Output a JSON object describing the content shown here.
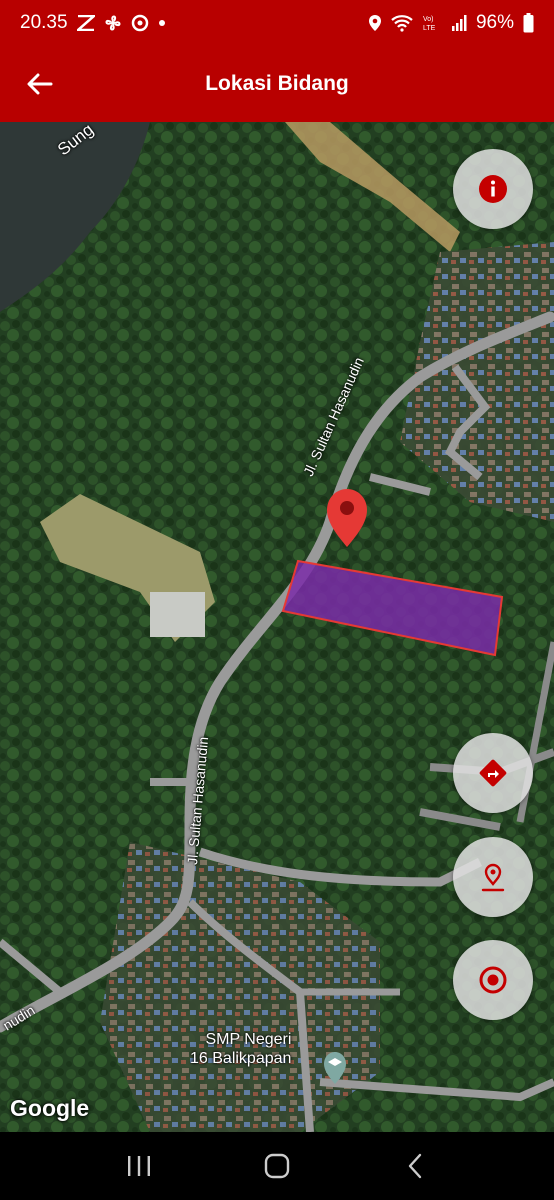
{
  "status_bar": {
    "time": "20.35",
    "battery": "96%",
    "left_icons": [
      "notification-app-icon",
      "fan-icon",
      "camera-app-icon",
      "dot-icon"
    ],
    "right_icons": [
      "location-icon",
      "wifi-icon",
      "volte-icon",
      "signal-icon",
      "battery-icon"
    ],
    "volte_label": "Vo)\nLTE"
  },
  "app_bar": {
    "title": "Lokasi Bidang",
    "back_icon": "arrow-left-icon"
  },
  "map": {
    "water_label": "Sung",
    "road_label_1": "Jl. Sultan Hasanudin",
    "road_label_2": "Jl. Sultan Hasanudin",
    "road_label_3": "nudin",
    "poi_label_line1": "SMP Negeri",
    "poi_label_line2": "16 Balikpapan",
    "attribution": "Google",
    "parcel_fill": "#7a2ca8",
    "parcel_stroke": "#e53935",
    "marker_color": "#e53935"
  },
  "fab_buttons": {
    "info": "info-icon",
    "directions": "directions-icon",
    "location_pin": "location-pin-icon",
    "my_location": "target-icon",
    "icon_color": "#c40000"
  },
  "nav_bar": {
    "recent": "recent-apps-icon",
    "home": "home-icon",
    "back": "back-icon"
  }
}
